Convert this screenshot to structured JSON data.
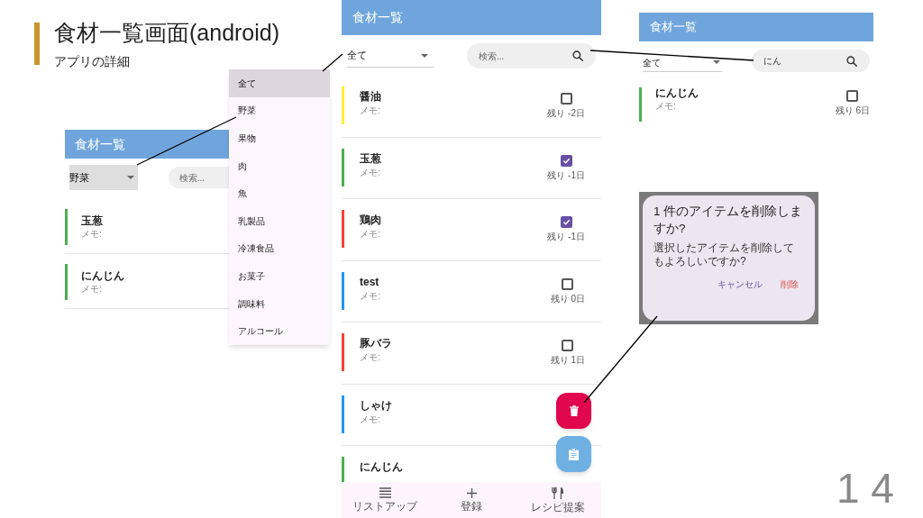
{
  "slide": {
    "title": "食材一覧画面(android)",
    "subtitle": "アプリの詳細",
    "page_number": "1 4"
  },
  "filtered_screen": {
    "header": "食材一覧",
    "filter": "野菜",
    "search": {
      "placeholder": "検索..."
    },
    "items": [
      {
        "name": "玉葱",
        "memo": "メモ:",
        "color": "#4caf50"
      },
      {
        "name": "にんじん",
        "memo": "メモ:",
        "color": "#4caf50"
      }
    ]
  },
  "category_menu": [
    {
      "label": "全て",
      "selected": true
    },
    {
      "label": "野菜",
      "selected": false
    },
    {
      "label": "果物",
      "selected": false
    },
    {
      "label": "肉",
      "selected": false
    },
    {
      "label": "魚",
      "selected": false
    },
    {
      "label": "乳製品",
      "selected": false
    },
    {
      "label": "冷凍食品",
      "selected": false
    },
    {
      "label": "お菓子",
      "selected": false
    },
    {
      "label": "調味料",
      "selected": false
    },
    {
      "label": "アルコール",
      "selected": false
    }
  ],
  "main_screen": {
    "header": "食材一覧",
    "filter": "全て",
    "search": {
      "placeholder": "検索..."
    },
    "items": [
      {
        "name": "醤油",
        "memo": "メモ:",
        "color": "#ffeb3b",
        "checked": false,
        "remaining": "残り -2日"
      },
      {
        "name": "玉葱",
        "memo": "メモ:",
        "color": "#4caf50",
        "checked": true,
        "remaining": "残り -1日"
      },
      {
        "name": "鶏肉",
        "memo": "メモ:",
        "color": "#f44336",
        "checked": true,
        "remaining": "残り -1日"
      },
      {
        "name": "test",
        "memo": "メモ:",
        "color": "#2196f3",
        "checked": false,
        "remaining": "残り 0日"
      },
      {
        "name": "豚バラ",
        "memo": "メモ:",
        "color": "#f44336",
        "checked": false,
        "remaining": "残り 1日"
      },
      {
        "name": "しゃけ",
        "memo": "メモ:",
        "color": "#2196f3"
      },
      {
        "name": "にんじん",
        "color": "#4caf50"
      }
    ],
    "fabs": [
      {
        "kind": "delete"
      },
      {
        "kind": "clipboard"
      }
    ],
    "bottom_nav": [
      {
        "label": "リストアップ",
        "kind": "list"
      },
      {
        "label": "登録",
        "kind": "add"
      },
      {
        "label": "レシピ提案",
        "kind": "recipe"
      }
    ]
  },
  "search_screen": {
    "header": "食材一覧",
    "filter": "全て",
    "search": {
      "value": "にん"
    },
    "items": [
      {
        "name": "にんじん",
        "memo": "メモ:",
        "color": "#4caf50",
        "checked": false,
        "remaining": "残り 6日"
      }
    ]
  },
  "delete_dialog": {
    "title": "1 件のアイテムを削除しますか?",
    "message": "選択したアイテムを削除してもよろしいですか?",
    "buttons": [
      {
        "label": "キャンセル",
        "kind": "cancel"
      },
      {
        "label": "削除",
        "kind": "delete"
      }
    ]
  }
}
